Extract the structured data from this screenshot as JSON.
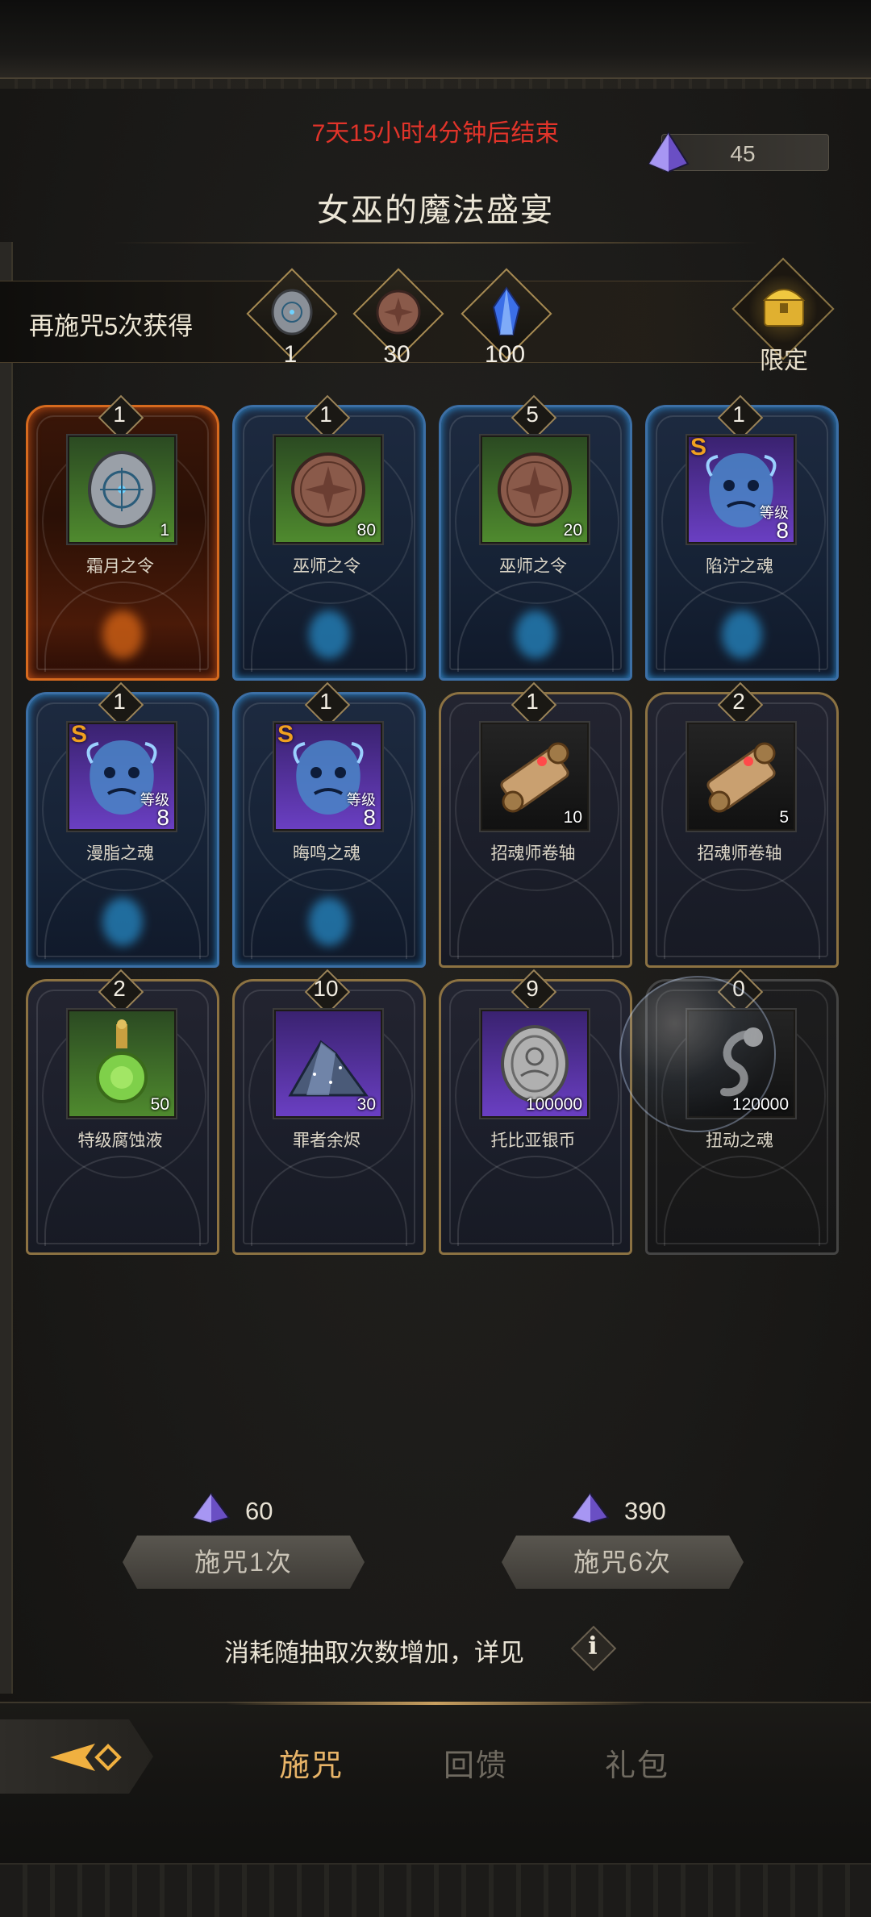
{
  "header": {
    "timer": "7天15小时4分钟后结束",
    "title": "女巫的魔法盛宴",
    "currency_value": "45"
  },
  "bonus": {
    "label": "再施咒5次获得",
    "items": [
      {
        "icon": "silver-medallion-icon",
        "count": "1"
      },
      {
        "icon": "bronze-coin-icon",
        "count": "30"
      },
      {
        "icon": "blue-crystal-icon",
        "count": "100"
      }
    ],
    "limited_label": "限定"
  },
  "items": [
    {
      "remaining": "1",
      "name": "霜月之令",
      "qty": "1",
      "rarity": "green",
      "frame": "red",
      "icon": "medallion-icon"
    },
    {
      "remaining": "1",
      "name": "巫师之令",
      "qty": "80",
      "rarity": "green",
      "frame": "blue",
      "icon": "bronze-coin-icon"
    },
    {
      "remaining": "5",
      "name": "巫师之令",
      "qty": "20",
      "rarity": "green",
      "frame": "blue",
      "icon": "bronze-coin-icon"
    },
    {
      "remaining": "1",
      "name": "陷泞之魂",
      "grade": "S",
      "level_label": "等级",
      "level": "8",
      "rarity": "purple",
      "frame": "blue",
      "icon": "soul-icon"
    },
    {
      "remaining": "1",
      "name": "漫脂之魂",
      "grade": "S",
      "level_label": "等级",
      "level": "8",
      "rarity": "purple",
      "frame": "blue",
      "icon": "soul-icon"
    },
    {
      "remaining": "1",
      "name": "晦鸣之魂",
      "grade": "S",
      "level_label": "等级",
      "level": "8",
      "rarity": "purple",
      "frame": "blue",
      "icon": "soul-icon"
    },
    {
      "remaining": "1",
      "name": "招魂师卷轴",
      "qty": "10",
      "rarity": "black",
      "frame": "gold",
      "icon": "scroll-icon"
    },
    {
      "remaining": "2",
      "name": "招魂师卷轴",
      "qty": "5",
      "rarity": "black",
      "frame": "gold",
      "icon": "scroll-icon"
    },
    {
      "remaining": "2",
      "name": "特级腐蚀液",
      "qty": "50",
      "rarity": "green",
      "frame": "gold",
      "icon": "potion-icon"
    },
    {
      "remaining": "10",
      "name": "罪者余烬",
      "qty": "30",
      "rarity": "purple",
      "frame": "gold",
      "icon": "ember-pile-icon"
    },
    {
      "remaining": "9",
      "name": "托比亚银币",
      "qty": "100000",
      "rarity": "purple",
      "frame": "gold",
      "icon": "silver-coin-icon"
    },
    {
      "remaining": "0",
      "name": "扭动之魂",
      "qty": "120000",
      "rarity": "black",
      "frame": "gray",
      "icon": "twisted-soul-icon"
    }
  ],
  "spell": {
    "one": {
      "cost": "60",
      "label": "施咒1次"
    },
    "six": {
      "cost": "390",
      "label": "施咒6次"
    }
  },
  "info": {
    "text": "消耗随抽取次数增加，详见",
    "button": "i"
  },
  "tabs": [
    {
      "label": "施咒",
      "active": true
    },
    {
      "label": "回馈",
      "active": false
    },
    {
      "label": "礼包",
      "active": false
    }
  ],
  "colors": {
    "timer": "#e2342a",
    "active_tab": "#e8b468",
    "inactive_tab": "#6f6a60"
  }
}
